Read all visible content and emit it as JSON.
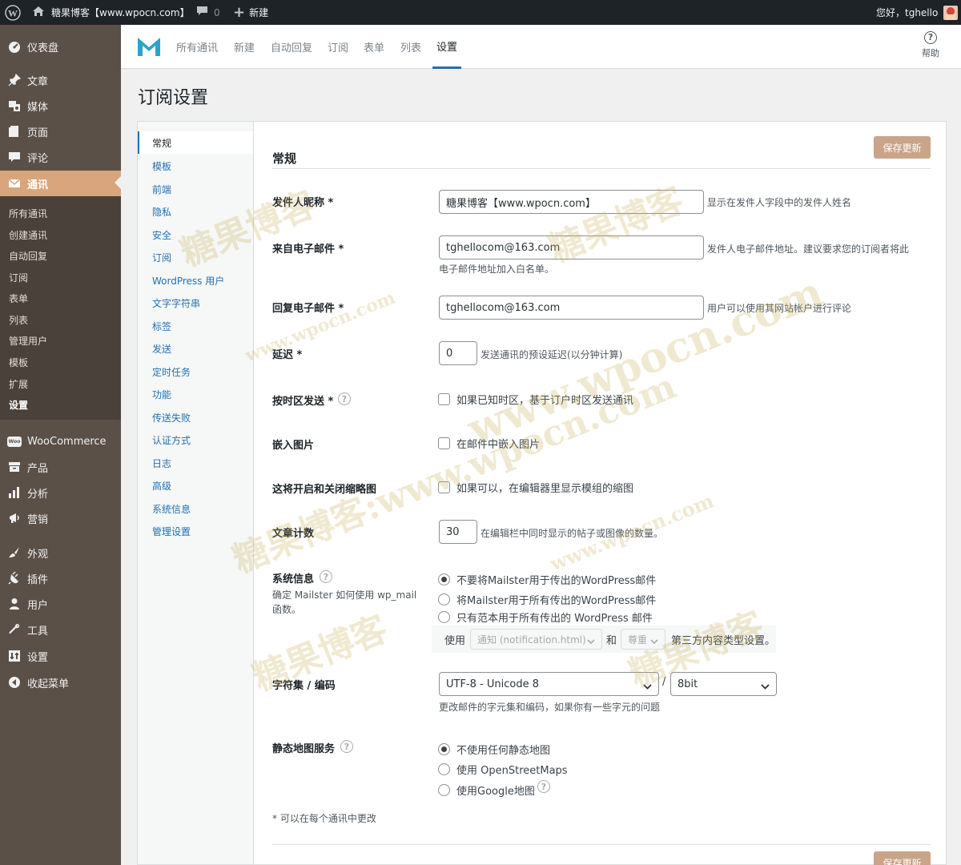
{
  "adminbar": {
    "site_name": "糖果博客【www.wpocn.com】",
    "comments_count": "0",
    "new_label": "新建",
    "greeting": "您好，tghello"
  },
  "sidebar": {
    "dashboard": "仪表盘",
    "posts": "文章",
    "media": "媒体",
    "pages": "页面",
    "comments": "评论",
    "newsletter": "通讯",
    "sub_items": [
      "所有通讯",
      "创建通讯",
      "自动回复",
      "订阅",
      "表单",
      "列表",
      "管理用户",
      "模板",
      "扩展",
      "设置"
    ],
    "woocommerce": "WooCommerce",
    "products": "产品",
    "analytics": "分析",
    "marketing": "营销",
    "appearance": "外观",
    "plugins": "插件",
    "users": "用户",
    "tools": "工具",
    "settings": "设置",
    "collapse": "收起菜单"
  },
  "topnav": {
    "tabs": [
      "所有通讯",
      "新建",
      "自动回复",
      "订阅",
      "表单",
      "列表",
      "设置"
    ],
    "help_label": "帮助"
  },
  "page_title": "订阅设置",
  "settings_nav": [
    "常规",
    "模板",
    "前端",
    "隐私",
    "安全",
    "订阅",
    "WordPress 用户",
    "文字字符串",
    "标签",
    "发送",
    "定时任务",
    "功能",
    "传送失败",
    "认证方式",
    "日志",
    "高级",
    "系统信息",
    "管理设置"
  ],
  "section_title": "常规",
  "save_label": "保存更新",
  "fields": {
    "sender_name_label": "发件人昵称",
    "sender_name_value": "糖果博客【www.wpocn.com】",
    "sender_name_desc": "显示在发件人字段中的发件人姓名",
    "from_email_label": "来自电子邮件",
    "from_email_value": "tghellocom@163.com",
    "from_email_desc1": "发件人电子邮件地址。建议要求您的订阅者将此",
    "from_email_desc2": "电子邮件地址加入白名单。",
    "reply_email_label": "回复电子邮件",
    "reply_email_value": "tghellocom@163.com",
    "reply_email_desc": "用户可以使用其网站帐户进行评论",
    "delay_label": "延迟",
    "delay_value": "0",
    "delay_desc": "发送通讯的预设延迟(以分钟计算)",
    "timezone_label": "按时区发送",
    "timezone_desc": "如果已知时区，基于订户时区发送通讯",
    "embed_label": "嵌入图片",
    "embed_desc": "在邮件中嵌入图片",
    "thumb_label": "这将开启和关闭缩略图",
    "thumb_desc": "如果可以，在编辑器里显示模组的缩图",
    "post_count_label": "文章计数",
    "post_count_value": "30",
    "post_count_desc": "在编辑栏中同时显示的帖子或图像的数量。",
    "system_label": "系统信息",
    "system_sub1": "确定 Mailster 如何使用 wp_mail",
    "system_sub2": "函数。",
    "system_opt1": "不要将Mailster用于传出的WordPress邮件",
    "system_opt2": "将Mailster用于所有传出的WordPress邮件",
    "system_opt3": "只有范本用于所有传出的 WordPress 邮件",
    "use_label": "使用",
    "template_select": "通知 (notification.html)",
    "and_label": "和",
    "respect_select": "尊重",
    "third_party_desc": "第三方内容类型设置。",
    "charset_label": "字符集 / 编码",
    "charset_value": "UTF-8 - Unicode 8",
    "encoding_value": "8bit",
    "charset_desc": "更改邮件的字元集和编码，如果你有一些字元的问题",
    "map_label": "静态地图服务",
    "map_opt1": "不使用任何静态地图",
    "map_opt2": "使用 OpenStreetMaps",
    "map_opt3": "使用Google地图",
    "footnote": "* 可以在每个通讯中更改"
  },
  "watermarks": [
    "糖果博客",
    "www.wpocn.com",
    "糖果博客",
    "www.wpocn.com",
    "糖果博客:www.wpocn.com",
    "www.wpocn.com",
    "糖果博客",
    "糖果博客"
  ],
  "colors": {
    "accent": "#d9a57c",
    "sidebar": "#5b5048",
    "adminbar": "#1d2327",
    "link": "#2271b1",
    "button": "#c9a489"
  }
}
